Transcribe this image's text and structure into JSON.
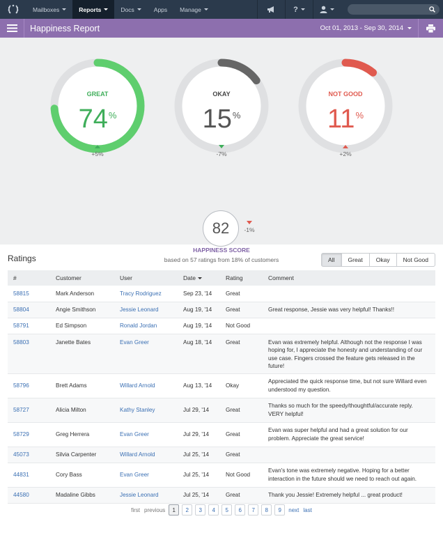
{
  "nav": {
    "logo_icon": "wreath-logo-icon",
    "items": [
      {
        "label": "Mailboxes",
        "dropdown": true,
        "active": false
      },
      {
        "label": "Reports",
        "dropdown": true,
        "active": true
      },
      {
        "label": "Docs",
        "dropdown": true,
        "active": false
      },
      {
        "label": "Apps",
        "dropdown": false,
        "active": false
      },
      {
        "label": "Manage",
        "dropdown": true,
        "active": false
      }
    ],
    "right_icons": [
      "megaphone-icon",
      "help-icon",
      "user-icon"
    ],
    "help_label": "?",
    "search_placeholder": ""
  },
  "header": {
    "title": "Happiness Report",
    "date_range": "Oct 01, 2013 - Sep 30, 2014",
    "accent": "#8d6fae"
  },
  "gauges": [
    {
      "label": "GREAT",
      "value": "74",
      "unit": "%",
      "change": "+5%",
      "fraction": 0.74,
      "color": "#5fce6e",
      "text_color": "#3fae5a",
      "label_color": "#3fae5a",
      "trend": "up",
      "trend_color": "green"
    },
    {
      "label": "OKAY",
      "value": "15",
      "unit": "%",
      "change": "-7%",
      "fraction": 0.15,
      "color": "#666666",
      "text_color": "#555555",
      "label_color": "#444444",
      "trend": "down",
      "trend_color": "green"
    },
    {
      "label": "NOT GOOD",
      "value": "11",
      "unit": "%",
      "change": "+2%",
      "fraction": 0.11,
      "color": "#e05a4f",
      "text_color": "#e05a4f",
      "label_color": "#e05a4f",
      "trend": "up",
      "trend_color": "red"
    }
  ],
  "score": {
    "value": "82",
    "change": "-1%",
    "label": "HAPPINESS SCORE",
    "sub": "based on 57 ratings from 18% of customers"
  },
  "ratings": {
    "title": "Ratings",
    "filters": [
      "All",
      "Great",
      "Okay",
      "Not Good"
    ],
    "active_filter": "All",
    "columns": {
      "id": "#",
      "customer": "Customer",
      "user": "User",
      "date": "Date",
      "rating": "Rating",
      "comment": "Comment"
    },
    "rows": [
      {
        "id": "58815",
        "customer": "Mark Anderson",
        "user": "Tracy Rodriguez",
        "date": "Sep 23, '14",
        "rating": "Great",
        "comment": ""
      },
      {
        "id": "58804",
        "customer": "Angie Smithson",
        "user": "Jessie Leonard",
        "date": "Aug 19, '14",
        "rating": "Great",
        "comment": "Great response, Jessie was very helpful! Thanks!!"
      },
      {
        "id": "58791",
        "customer": "Ed Simpson",
        "user": "Ronald Jordan",
        "date": "Aug 19, '14",
        "rating": "Not Good",
        "comment": ""
      },
      {
        "id": "58803",
        "customer": "Janette Bates",
        "user": "Evan Greer",
        "date": "Aug 18, '14",
        "rating": "Great",
        "comment": "Evan was extremely helpful. Although not the response I was hoping for, I appreciate the honesty and understanding of our use case. Fingers crossed the feature gets released in the future!"
      },
      {
        "id": "58796",
        "customer": "Brett Adams",
        "user": "Willard Arnold",
        "date": "Aug 13, '14",
        "rating": "Okay",
        "comment": "Appreciated the quick response time, but not sure Willard even understood my question."
      },
      {
        "id": "58727",
        "customer": "Alicia Milton",
        "user": "Kathy Stanley",
        "date": "Jul 29, '14",
        "rating": "Great",
        "comment": "Thanks so much for the speedy/thoughtful/accurate reply. VERY helpful!"
      },
      {
        "id": "58729",
        "customer": "Greg Herrera",
        "user": "Evan Greer",
        "date": "Jul 29, '14",
        "rating": "Great",
        "comment": "Evan was super helpful and had a great solution for our problem. Appreciate the great service!"
      },
      {
        "id": "45073",
        "customer": "Silvia Carpenter",
        "user": "Willard Arnold",
        "date": "Jul 25, '14",
        "rating": "Great",
        "comment": ""
      },
      {
        "id": "44831",
        "customer": "Cory Bass",
        "user": "Evan Greer",
        "date": "Jul 25, '14",
        "rating": "Not Good",
        "comment": "Evan's tone was extremely negative. Hoping for a better interaction in the future should we need to reach out again."
      },
      {
        "id": "44580",
        "customer": "Madaline Gibbs",
        "user": "Jessie Leonard",
        "date": "Jul 25, '14",
        "rating": "Great",
        "comment": "Thank you Jessie! Extremely helpful ... great product!"
      }
    ]
  },
  "pagination": {
    "first": "first",
    "previous": "previous",
    "pages": [
      "1",
      "2",
      "3",
      "4",
      "5",
      "6",
      "7",
      "8",
      "9"
    ],
    "current": "1",
    "next": "next",
    "last": "last"
  }
}
